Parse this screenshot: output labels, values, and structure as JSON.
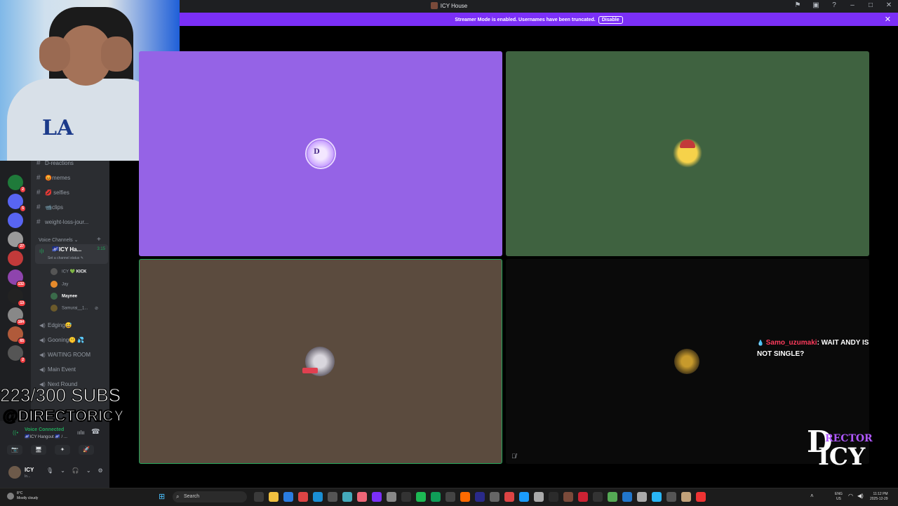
{
  "window": {
    "title": "ICY House"
  },
  "banner": {
    "message": "Streamer Mode is enabled. Usernames have been truncated.",
    "disable_label": "Disable",
    "close": "✕"
  },
  "servers": [
    {
      "badge": "2",
      "color": "#1f7a3a"
    },
    {
      "badge": "5",
      "color": "#5865f2"
    },
    {
      "badge": "",
      "color": "#5865f2"
    },
    {
      "badge": "27",
      "color": "#9a9a9a"
    },
    {
      "badge": "",
      "color": "#c23a3a"
    },
    {
      "badge": "132",
      "color": "#8e44ad"
    },
    {
      "badge": "13",
      "color": "#222"
    },
    {
      "badge": "184",
      "color": "#888"
    },
    {
      "badge": "65",
      "color": "#b05a3a"
    },
    {
      "badge": "2",
      "color": "#555"
    }
  ],
  "channels": {
    "text": [
      {
        "name": "D-reactions"
      },
      {
        "name": "😡memes"
      },
      {
        "name": "💋 selfies"
      },
      {
        "name": "📹clips"
      },
      {
        "name": "weight-loss-jour..."
      }
    ],
    "voice_header": "Voice Channels",
    "active_voice": {
      "name": "🌌ICY Ha...",
      "time": "3:15",
      "status": "Set a channel status ✎"
    },
    "members": [
      {
        "name": "ICY",
        "extra": "💚 KICK",
        "color": "#555"
      },
      {
        "name": "Jay",
        "extra": "",
        "color": "#e58a2b"
      },
      {
        "name": "Maynee",
        "extra": "",
        "color": "#3a6b4a"
      },
      {
        "name": "Samurai__1...",
        "extra": "",
        "color": "#6b5a2b"
      }
    ],
    "voice": [
      {
        "name": "Edging😅"
      },
      {
        "name": "Gooning🤫 💦"
      },
      {
        "name": "WAITING ROOM"
      },
      {
        "name": "Main Event"
      },
      {
        "name": "Next Round"
      }
    ]
  },
  "voice_panel": {
    "connected": "Voice Connected",
    "channel": "🌌ICY Hangout 🌌 / ...",
    "buttons": [
      "📷",
      "🖥",
      "✦",
      "🚀"
    ]
  },
  "user": {
    "name": "ICY",
    "status": "In..."
  },
  "overlay": {
    "subs": "223/300 SUBS",
    "handle": "@DIRECTORICY",
    "chat_user": "Samo_uzumaki",
    "chat_message": ": WAIT ANDY IS NOT SINGLE?",
    "brand_d": "D",
    "brand_rector": "RECTOR",
    "brand_icy": "ICY"
  },
  "taskbar": {
    "weather_temp": "8°C",
    "weather_desc": "Mostly cloudy",
    "search_placeholder": "Search",
    "lang": "ENG",
    "region": "US",
    "time": "11:12 PM",
    "date": "2025-12-29"
  }
}
